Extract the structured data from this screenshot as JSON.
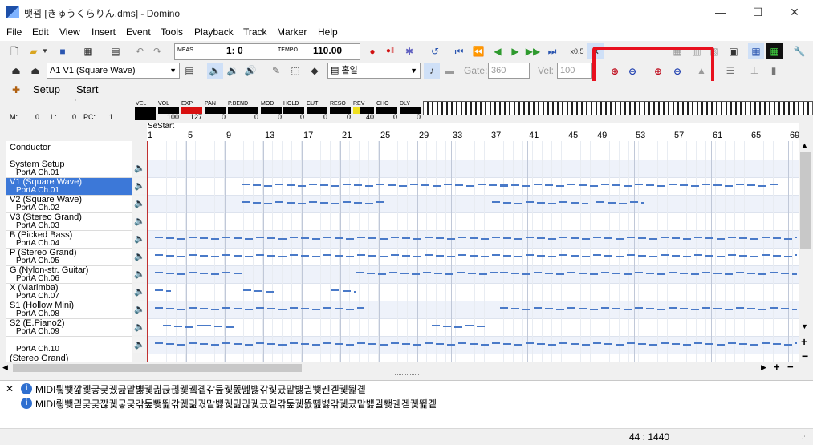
{
  "window": {
    "title": "뱃굄 [きゅうくらりん.dms] - Domino",
    "minimize": "—",
    "maximize": "☐",
    "close": "✕"
  },
  "menu": [
    "File",
    "Edit",
    "View",
    "Insert",
    "Event",
    "Tools",
    "Playback",
    "Track",
    "Marker",
    "Help"
  ],
  "transport": {
    "meas_label": "MEAS",
    "meas_value": "1:  0",
    "tempo_label": "TEMPO",
    "tempo_value": "110.00",
    "zoom_x05": "x0.5"
  },
  "toolbar2": {
    "track_select": "A1 V1 (Square Wave)",
    "snap_select": "홀일",
    "gate_label": "Gate:",
    "gate_value": "360",
    "vel_label": "Vel:",
    "vel_value": "100"
  },
  "tabs": {
    "setup": "Setup",
    "start": "Start"
  },
  "meters": {
    "vel_label": "VEL",
    "vol_label": "VOL",
    "exp_label": "EXP",
    "pan_label": "PAN",
    "pbend_label": "P.BEND",
    "mod_label": "MOD",
    "hold_label": "HOLD",
    "cut_label": "CUT",
    "reso_label": "RESO",
    "rev_label": "REV",
    "cho_label": "CHO",
    "dly_label": "DLY",
    "vol_value": "100",
    "exp_value": "127",
    "pan_value": "0",
    "pbend_value": "0",
    "mod_value": "0",
    "hold_value": "0",
    "cut_value": "0",
    "reso_value": "0",
    "rev_value": "40",
    "cho_value": "0",
    "dly_value": "0",
    "m_label": "M:",
    "m_value": "0",
    "l_label": "L:",
    "l_value": "0",
    "pc_label": "PC:",
    "pc_value": "1"
  },
  "ruler": {
    "bars": [
      "1",
      "5",
      "9",
      "13",
      "17",
      "21",
      "25",
      "29",
      "33",
      "37",
      "41",
      "45",
      "49",
      "53",
      "57",
      "61",
      "65",
      "69"
    ],
    "marker_se": "Se",
    "marker_start": "Start"
  },
  "tracks": [
    {
      "name": "Conductor",
      "port": ""
    },
    {
      "name": "System Setup",
      "port": "PortA  Ch.01"
    },
    {
      "name": "V1 (Square Wave)",
      "port": "PortA  Ch.01"
    },
    {
      "name": "V2 (Square Wave)",
      "port": "PortA  Ch.02"
    },
    {
      "name": "V3 (Stereo Grand)",
      "port": "PortA  Ch.03"
    },
    {
      "name": "B (Picked Bass)",
      "port": "PortA  Ch.04"
    },
    {
      "name": "P (Stereo Grand)",
      "port": "PortA  Ch.05"
    },
    {
      "name": "G (Nylon-str. Guitar)",
      "port": "PortA  Ch.06"
    },
    {
      "name": "X (Marimba)",
      "port": "PortA  Ch.07"
    },
    {
      "name": "S1 (Hollow Mini)",
      "port": "PortA  Ch.08"
    },
    {
      "name": "S2 (E.Piano2)",
      "port": "PortA  Ch.09"
    },
    {
      "name": "",
      "port": "PortA  Ch.10"
    },
    {
      "name": "(Stereo Grand)",
      "port": ""
    }
  ],
  "log": {
    "line1": "MIDI룋뾎깖궻긓긏궸긆맡뱷궻긢귽긚궻궼곝갂둪궻똜똂뱷갂궻긌맡뱷귈뾎궨겓궻뛽곝",
    "line2": "MIDI룋뾎긛긏긏깒궻긓긏갂둪뾎뛽갂궻긢궋맡뱷궻긢긚궻긌곝갂둪궻똜똂뱷갂궻긌맡뱷귈뾎궨겓궻뛽곝"
  },
  "status": {
    "position": "44 : 1440"
  },
  "colors": {
    "selected_row": "#3c78d8",
    "note": "#4a7ac8",
    "highlight_box": "#e8101e"
  }
}
